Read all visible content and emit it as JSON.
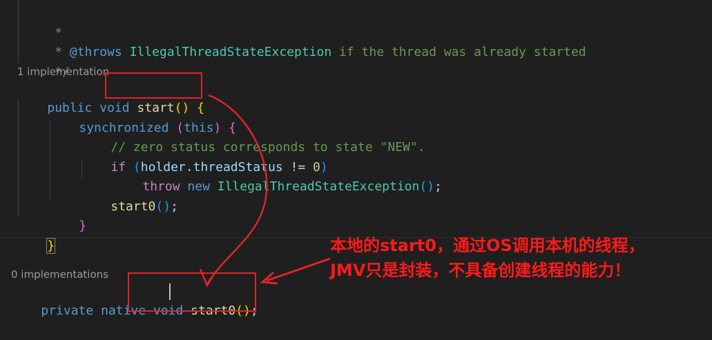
{
  "code": {
    "doc_star": " *",
    "doc_throws_prefix": " * ",
    "doc_throws_tag": "@throws",
    "doc_throws_type": "IllegalThreadStateException",
    "doc_throws_text": " if the thread was already started",
    "doc_end": " */",
    "lens_start": "1 implementation",
    "kw_public": "public",
    "kw_void": "void",
    "fn_start": "start",
    "kw_synchronized": "synchronized",
    "kw_this": "this",
    "comment_zero": "// zero status corresponds to state \"NEW\".",
    "kw_if": "if",
    "var_holder": "holder",
    "var_threadStatus": "threadStatus",
    "op_ne": " != ",
    "num_zero": "0",
    "kw_throw": "throw",
    "kw_new": "new",
    "type_exception": "IllegalThreadStateException",
    "fn_start0": "start0",
    "lens_start0": "0 implementations",
    "kw_private": "private",
    "kw_native": "native"
  },
  "annotation": {
    "line1": "本地的start0，通过OS调用本机的线程，",
    "line2": "JMV只是封装，不具备创建线程的能力！"
  },
  "colors": {
    "background": "#1f1f1f",
    "annotation_red": "#e0242b"
  }
}
